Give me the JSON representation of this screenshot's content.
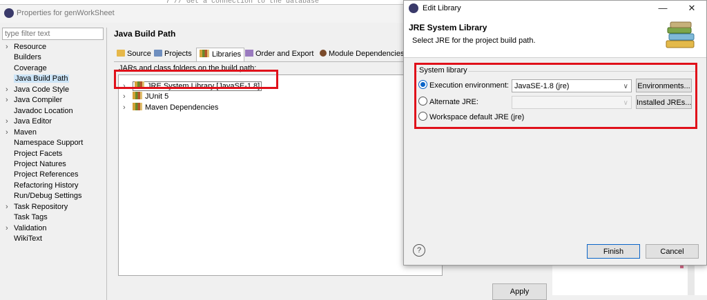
{
  "editor_snippet": "7     // Get a connection to the database",
  "properties": {
    "title": "Properties for genWorkSheet",
    "filter_placeholder": "type filter text",
    "nav": [
      {
        "label": "Resource",
        "expandable": true
      },
      {
        "label": "Builders",
        "expandable": false
      },
      {
        "label": "Coverage",
        "expandable": false
      },
      {
        "label": "Java Build Path",
        "expandable": false,
        "selected": true
      },
      {
        "label": "Java Code Style",
        "expandable": true
      },
      {
        "label": "Java Compiler",
        "expandable": true
      },
      {
        "label": "Javadoc Location",
        "expandable": false
      },
      {
        "label": "Java Editor",
        "expandable": true
      },
      {
        "label": "Maven",
        "expandable": true
      },
      {
        "label": "Namespace Support",
        "expandable": false
      },
      {
        "label": "Project Facets",
        "expandable": false
      },
      {
        "label": "Project Natures",
        "expandable": false
      },
      {
        "label": "Project References",
        "expandable": false
      },
      {
        "label": "Refactoring History",
        "expandable": false
      },
      {
        "label": "Run/Debug Settings",
        "expandable": false
      },
      {
        "label": "Task Repository",
        "expandable": true
      },
      {
        "label": "Task Tags",
        "expandable": false
      },
      {
        "label": "Validation",
        "expandable": true
      },
      {
        "label": "WikiText",
        "expandable": false
      }
    ],
    "page_title": "Java Build Path",
    "tabs": [
      "Source",
      "Projects",
      "Libraries",
      "Order and Export",
      "Module Dependencies"
    ],
    "active_tab": "Libraries",
    "build_path_label": "JARs and class folders on the build path:",
    "tree": [
      "JRE System Library [JavaSE-1.8]",
      "JUnit 5",
      "Maven Dependencies"
    ],
    "apply_label": "Apply"
  },
  "dialog": {
    "title": "Edit Library",
    "heading": "JRE System Library",
    "subtitle": "Select JRE for the project build path.",
    "group_label": "System library",
    "execution_env_label": "Execution environment:",
    "execution_env_value": "JavaSE-1.8 (jre)",
    "environments_button": "Environments...",
    "alternate_jre_label": "Alternate JRE:",
    "alternate_jre_value": "",
    "installed_jres_button": "Installed JREs...",
    "workspace_default_label": "Workspace default JRE (jre)",
    "finish_label": "Finish",
    "cancel_label": "Cancel",
    "help_glyph": "?"
  },
  "colors": {
    "highlight_red": "#e0101a",
    "selection_blue": "#cce4f7",
    "radio_blue": "#0a64c8"
  }
}
